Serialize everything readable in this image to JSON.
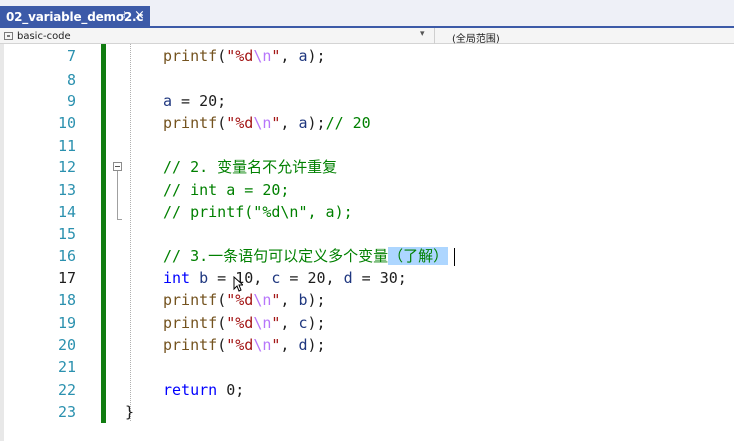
{
  "tab": {
    "title": "02_variable_demo2.c",
    "pin": "⊣",
    "close": "×"
  },
  "nav": {
    "left_label": "basic-code",
    "dropdown": "▾",
    "right_label": "(全局范围)"
  },
  "lines": [
    {
      "num": "7",
      "current": false
    },
    {
      "num": "8",
      "current": false
    },
    {
      "num": "9",
      "current": false
    },
    {
      "num": "10",
      "current": false
    },
    {
      "num": "11",
      "current": false
    },
    {
      "num": "12",
      "current": false
    },
    {
      "num": "13",
      "current": false
    },
    {
      "num": "14",
      "current": false
    },
    {
      "num": "15",
      "current": false
    },
    {
      "num": "16",
      "current": false
    },
    {
      "num": "17",
      "current": true
    },
    {
      "num": "18",
      "current": false
    },
    {
      "num": "19",
      "current": false
    },
    {
      "num": "20",
      "current": false
    },
    {
      "num": "21",
      "current": false
    },
    {
      "num": "22",
      "current": false
    },
    {
      "num": "23",
      "current": false
    }
  ],
  "code": {
    "l7": {
      "fn": "printf",
      "open": "(",
      "s1": "\"%d",
      "esc": "\\n",
      "s2": "\"",
      "rest": ", ",
      "v": "a",
      "end": ");"
    },
    "l9": {
      "v": "a",
      "rest": " = 20;"
    },
    "l10": {
      "fn": "printf",
      "open": "(",
      "s1": "\"%d",
      "esc": "\\n",
      "s2": "\"",
      "rest": ", ",
      "v": "a",
      "end": ");",
      "cmt": "// 20"
    },
    "l12": {
      "cmt": "// 2. 变量名不允许重复"
    },
    "l13": {
      "cmt": "// int a = 20;"
    },
    "l14": {
      "cmt": "// printf(\"%d\\n\", a);"
    },
    "l16": {
      "cmt": "// 3.一条语句可以定义多个变量",
      "hl": "（了解）"
    },
    "l17": {
      "kw": "int",
      "v1": "b",
      "t1": " = 10, ",
      "v2": "c",
      "t2": " = 20, ",
      "v3": "d",
      "t3": " = 30;"
    },
    "l18": {
      "fn": "printf",
      "open": "(",
      "s1": "\"%d",
      "esc": "\\n",
      "s2": "\"",
      "rest": ", ",
      "v": "b",
      "end": ");"
    },
    "l19": {
      "fn": "printf",
      "open": "(",
      "s1": "\"%d",
      "esc": "\\n",
      "s2": "\"",
      "rest": ", ",
      "v": "c",
      "end": ");"
    },
    "l20": {
      "fn": "printf",
      "open": "(",
      "s1": "\"%d",
      "esc": "\\n",
      "s2": "\"",
      "rest": ", ",
      "v": "d",
      "end": ");"
    },
    "l22": {
      "kw": "return",
      "rest": " 0;"
    },
    "l23": {
      "brace": "}"
    }
  },
  "colors": {
    "tab_active": "#3c5aa8",
    "line_number": "#2b91af",
    "change_bar": "#107c10",
    "comment": "#008000",
    "keyword": "#0000ff",
    "string": "#a31515",
    "escape": "#b776fb",
    "variable": "#1f377f",
    "function": "#74531f",
    "selection": "#add6ff"
  }
}
